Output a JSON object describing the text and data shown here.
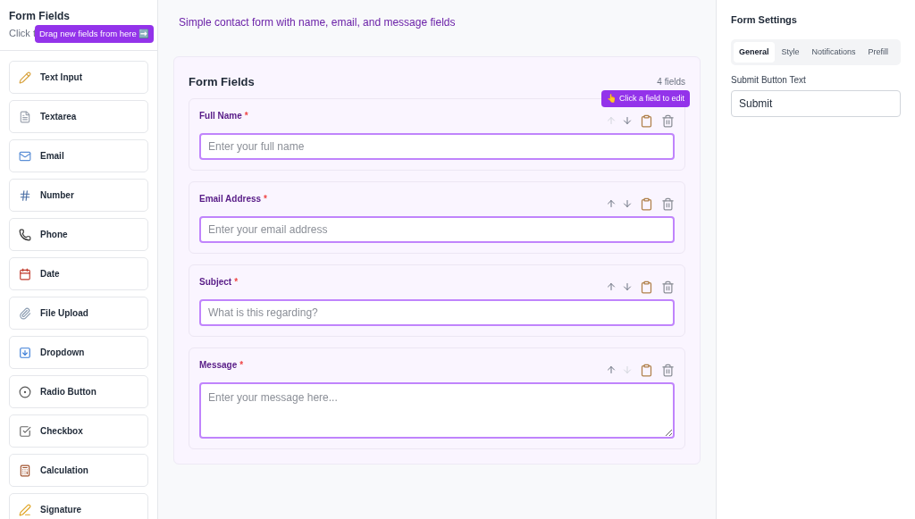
{
  "palette": {
    "title": "Form Fields",
    "subtitle": "Click t",
    "tooltip": "Drag new fields from here ➡️",
    "items": [
      {
        "label": "Text Input"
      },
      {
        "label": "Textarea"
      },
      {
        "label": "Email"
      },
      {
        "label": "Number"
      },
      {
        "label": "Phone"
      },
      {
        "label": "Date"
      },
      {
        "label": "File Upload"
      },
      {
        "label": "Dropdown"
      },
      {
        "label": "Radio Button"
      },
      {
        "label": "Checkbox"
      },
      {
        "label": "Calculation"
      },
      {
        "label": "Signature"
      }
    ]
  },
  "description": "Simple contact form with name, email, and message fields",
  "form": {
    "title": "Form Fields",
    "count": "4 fields",
    "tooltip": "👆 Click a field to edit",
    "fields": [
      {
        "kind": "input",
        "label": "Full Name",
        "required_mark": "*",
        "placeholder": "Enter your full name",
        "up_disabled": true,
        "down_disabled": false
      },
      {
        "kind": "input",
        "label": "Email Address",
        "required_mark": "*",
        "placeholder": "Enter your email address",
        "up_disabled": false,
        "down_disabled": false
      },
      {
        "kind": "input",
        "label": "Subject",
        "required_mark": "*",
        "placeholder": "What is this regarding?",
        "up_disabled": false,
        "down_disabled": false
      },
      {
        "kind": "textarea",
        "label": "Message",
        "required_mark": "*",
        "placeholder": "Enter your message here...",
        "up_disabled": false,
        "down_disabled": true
      }
    ]
  },
  "settings": {
    "title": "Form Settings",
    "tabs": [
      {
        "label": "General",
        "selected": true
      },
      {
        "label": "Style",
        "selected": false
      },
      {
        "label": "Notifications",
        "selected": false
      },
      {
        "label": "Prefill",
        "selected": false
      }
    ],
    "field_label": "Submit Button Text",
    "field_value": "Submit"
  }
}
